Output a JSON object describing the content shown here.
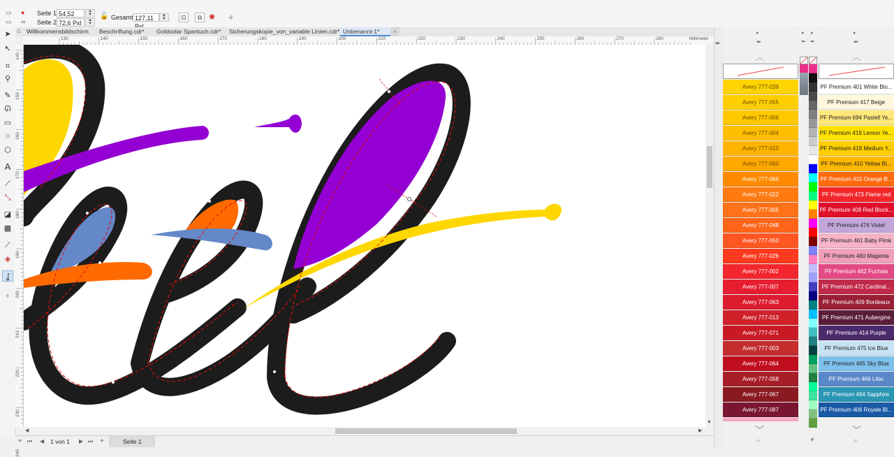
{
  "propbar": {
    "page1_label": "Seite 1:",
    "page1_value": "54,52 Pxl",
    "page2_label": "Seite 2:",
    "page2_value": "72,6 Pxl",
    "total_label": "Gesamt:",
    "total_value": "127,11 Pxl"
  },
  "tabs": [
    {
      "label": "Willkommensbildschirm"
    },
    {
      "label": "Beschriftung.cdr*"
    },
    {
      "label": "Goldsolar Spantuch.cdr*"
    },
    {
      "label": "Sicherungskopie_von_variable Linien.cdr*"
    },
    {
      "label": "Unbenannt-1*"
    }
  ],
  "add_tab_glyph": "+",
  "ruler": {
    "unit": "Millimeter",
    "ticks": [
      "130",
      "140",
      "150",
      "160",
      "170",
      "180",
      "190",
      "200",
      "210",
      "220",
      "230",
      "240",
      "250",
      "260",
      "270",
      "280"
    ],
    "vticks": [
      "140",
      "150",
      "160",
      "170",
      "180",
      "190",
      "200",
      "210",
      "220",
      "230",
      "240"
    ]
  },
  "status": {
    "page_of": "1 von 1",
    "page_tab": "Seite 1"
  },
  "palette_avery": [
    {
      "label": "Avery 777-039",
      "color": "#FFD400"
    },
    {
      "label": "Avery 777-055",
      "color": "#FFCE00"
    },
    {
      "label": "Avery 777-006",
      "color": "#FFC800"
    },
    {
      "label": "Avery 777-004",
      "color": "#FFBE00"
    },
    {
      "label": "Avery 777-010",
      "color": "#FFB400"
    },
    {
      "label": "Avery 777-060",
      "color": "#FFA800"
    },
    {
      "label": "Avery 777-066",
      "color": "#FF8A00"
    },
    {
      "label": "Avery 777-022",
      "color": "#FF7A10"
    },
    {
      "label": "Avery 777-005",
      "color": "#FF7218"
    },
    {
      "label": "Avery 777-048",
      "color": "#FF6418"
    },
    {
      "label": "Avery 777-050",
      "color": "#FF5622"
    },
    {
      "label": "Avery 777-026",
      "color": "#FF3A1E"
    },
    {
      "label": "Avery 777-002",
      "color": "#F2262C"
    },
    {
      "label": "Avery 777-007",
      "color": "#E61E30"
    },
    {
      "label": "Avery 777-063",
      "color": "#DC1C2E"
    },
    {
      "label": "Avery 777-013",
      "color": "#D0202A"
    },
    {
      "label": "Avery 777-071",
      "color": "#C81A24"
    },
    {
      "label": "Avery 777-003",
      "color": "#C42E2E"
    },
    {
      "label": "Avery 777-064",
      "color": "#C00E1E"
    },
    {
      "label": "Avery 777-058",
      "color": "#A81E28"
    },
    {
      "label": "Avery 777-067",
      "color": "#8A1A22"
    },
    {
      "label": "Avery 777-087",
      "color": "#7A1632"
    }
  ],
  "palette_pf": [
    {
      "label": "PF Premium 401 White Blo...",
      "color": "#FFFFFF",
      "text": "#222222"
    },
    {
      "label": "PF Premium 417 Beige",
      "color": "#FFF6DC",
      "text": "#222222"
    },
    {
      "label": "PF Premium 694 Pastell Ye...",
      "color": "#FFE87A",
      "text": "#222222"
    },
    {
      "label": "PF Premium 419 Lemon Ye...",
      "color": "#FFE200",
      "text": "#222222"
    },
    {
      "label": "PF Premium 418 Medium Y...",
      "color": "#FFCE00",
      "text": "#222222"
    },
    {
      "label": "PF Premium 410 Yellow Bl...",
      "color": "#FFB800",
      "text": "#222222"
    },
    {
      "label": "PF Premium 415 Orange B...",
      "color": "#FF6A10",
      "text": "#FFFFFF"
    },
    {
      "label": "PF Premium 473 Flame red",
      "color": "#F2262A",
      "text": "#FFFFFF"
    },
    {
      "label": "PF Premium 408 Red Block...",
      "color": "#E0102A",
      "text": "#FFFFFF"
    },
    {
      "label": "PF Premium 476 Violet",
      "color": "#C2A6DA",
      "text": "#222222"
    },
    {
      "label": "PF Premium 461 Baby Pimk",
      "color": "#F6B4C8",
      "text": "#222222"
    },
    {
      "label": "PF Premium 460 Magenta",
      "color": "#F0A0B8",
      "text": "#222222"
    },
    {
      "label": "PF Premium 462 Fuchsia",
      "color": "#E24A86",
      "text": "#FFFFFF"
    },
    {
      "label": "PF Premium 472 Cardinal...",
      "color": "#C02A48",
      "text": "#FFFFFF"
    },
    {
      "label": "PF Premium 409 Bordeaux",
      "color": "#9A1E36",
      "text": "#FFFFFF"
    },
    {
      "label": "PF Premium 471 Aubergine",
      "color": "#5A1E3A",
      "text": "#FFFFFF"
    },
    {
      "label": "PF Premium 414 Purple",
      "color": "#4A2A6A",
      "text": "#FFFFFF"
    },
    {
      "label": "PF Premium 475 Ice Blue",
      "color": "#C8E2F4",
      "text": "#222222"
    },
    {
      "label": "PF Premium 465 Sky Blue",
      "color": "#7EC0EC",
      "text": "#222222"
    },
    {
      "label": "PF Premium 466 Lilac",
      "color": "#5A88C8",
      "text": "#FFFFFF"
    },
    {
      "label": "PF Premium 464 Sapphire",
      "color": "#2A96B4",
      "text": "#FFFFFF"
    },
    {
      "label": "PF Premium 406 Royale Bl...",
      "color": "#1A5AA6",
      "text": "#FFFFFF"
    }
  ],
  "mini_palette": [
    "#E8308A",
    "#111111",
    "#333333",
    "#4A4A4A",
    "#666666",
    "#808080",
    "#999999",
    "#B3B3B3",
    "#CCCCCC",
    "#E6E6E6",
    "#FFFFFF",
    "#0000FF",
    "#00FFFF",
    "#00FF00",
    "#00FF80",
    "#FFFF00",
    "#FF8000",
    "#FF00FF",
    "#FF0000",
    "#800000",
    "#8080FF",
    "#FF80C0",
    "#C0C0FF",
    "#A0A0FF",
    "#4040C0",
    "#000080",
    "#008080",
    "#00C0FF",
    "#80FFFF",
    "#40C0C0",
    "#208080",
    "#004040",
    "#00A060",
    "#60C080",
    "#208040",
    "#00FF99",
    "#40E0A0",
    "#A0FFC0",
    "#80C080",
    "#60A040"
  ],
  "colors": {
    "stroke": "#1c1c1c",
    "yellow": "#FFD700",
    "purple": "#9400D3",
    "orange": "#FF6A00",
    "blue": "#6488C8",
    "dash": "#E01010",
    "accent": "#4a8bd6"
  }
}
